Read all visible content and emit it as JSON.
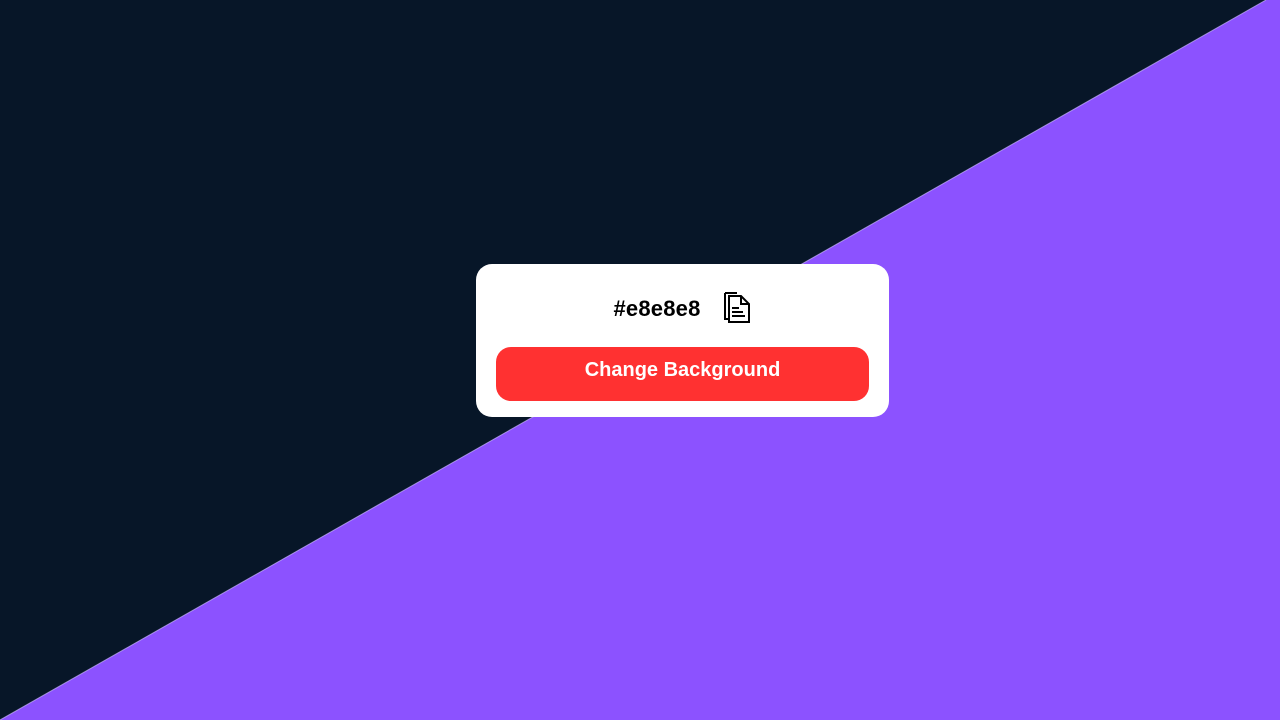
{
  "background": {
    "dark_color": "#071628",
    "light_color": "#8c52ff"
  },
  "card": {
    "color_code": "#e8e8e8",
    "copy_icon": "copy-icon",
    "button_label": "Change Background",
    "button_color": "#ff3131"
  }
}
